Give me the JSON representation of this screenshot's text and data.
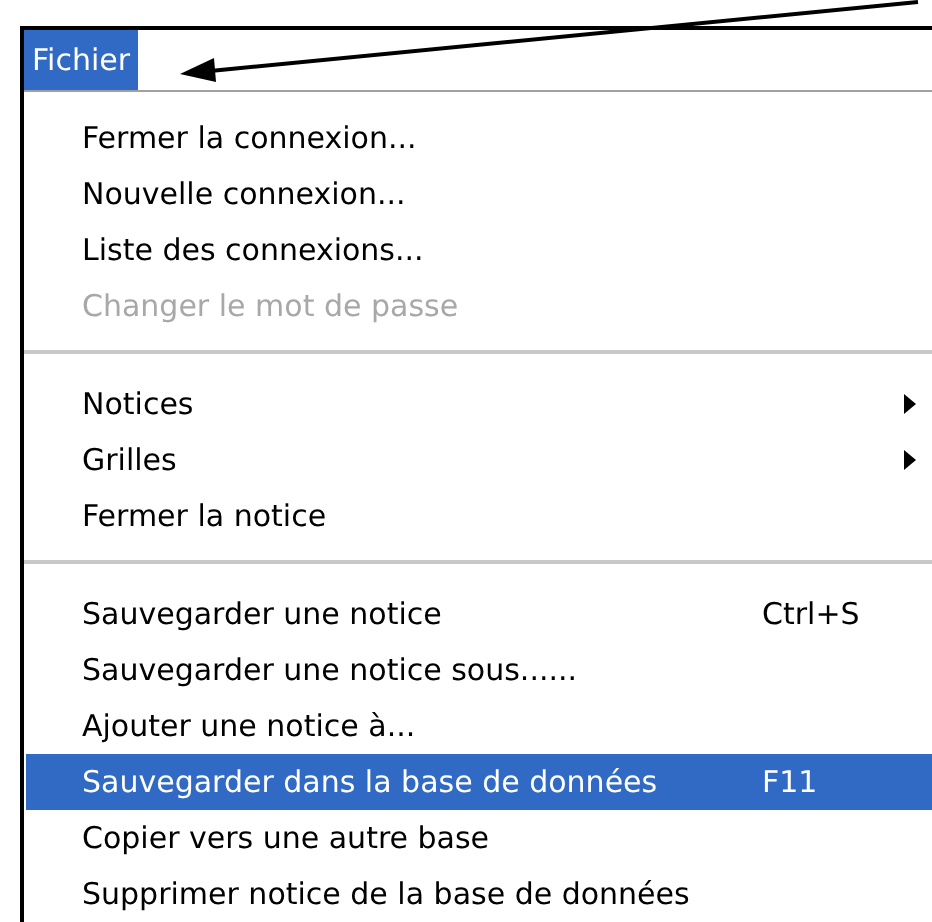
{
  "menu_bar": [
    {
      "label": "Fichier",
      "selected": true
    }
  ],
  "menu": {
    "groups": [
      [
        {
          "label": "Fermer la connexion...",
          "disabled": false,
          "selected": false,
          "submenu": false
        },
        {
          "label": "Nouvelle connexion...",
          "disabled": false,
          "selected": false,
          "submenu": false
        },
        {
          "label": "Liste des connexions...",
          "disabled": false,
          "selected": false,
          "submenu": false
        },
        {
          "label": "Changer le mot de passe",
          "disabled": true,
          "selected": false,
          "submenu": false
        }
      ],
      [
        {
          "label": "Notices",
          "disabled": false,
          "selected": false,
          "submenu": true
        },
        {
          "label": "Grilles",
          "disabled": false,
          "selected": false,
          "submenu": true
        },
        {
          "label": "Fermer la notice",
          "disabled": false,
          "selected": false,
          "submenu": false
        }
      ],
      [
        {
          "label": "Sauvegarder une notice",
          "shortcut": "Ctrl+S",
          "disabled": false,
          "selected": false,
          "submenu": false
        },
        {
          "label": "Sauvegarder une notice sous......",
          "disabled": false,
          "selected": false,
          "submenu": false
        },
        {
          "label": "Ajouter une notice à...",
          "disabled": false,
          "selected": false,
          "submenu": false
        },
        {
          "label": "Sauvegarder dans la base de données",
          "shortcut": "F11",
          "disabled": false,
          "selected": true,
          "submenu": false
        },
        {
          "label": "Copier vers une autre base",
          "disabled": false,
          "selected": false,
          "submenu": false
        },
        {
          "label": "Supprimer notice de la base de données",
          "disabled": false,
          "selected": false,
          "submenu": false
        }
      ]
    ]
  }
}
